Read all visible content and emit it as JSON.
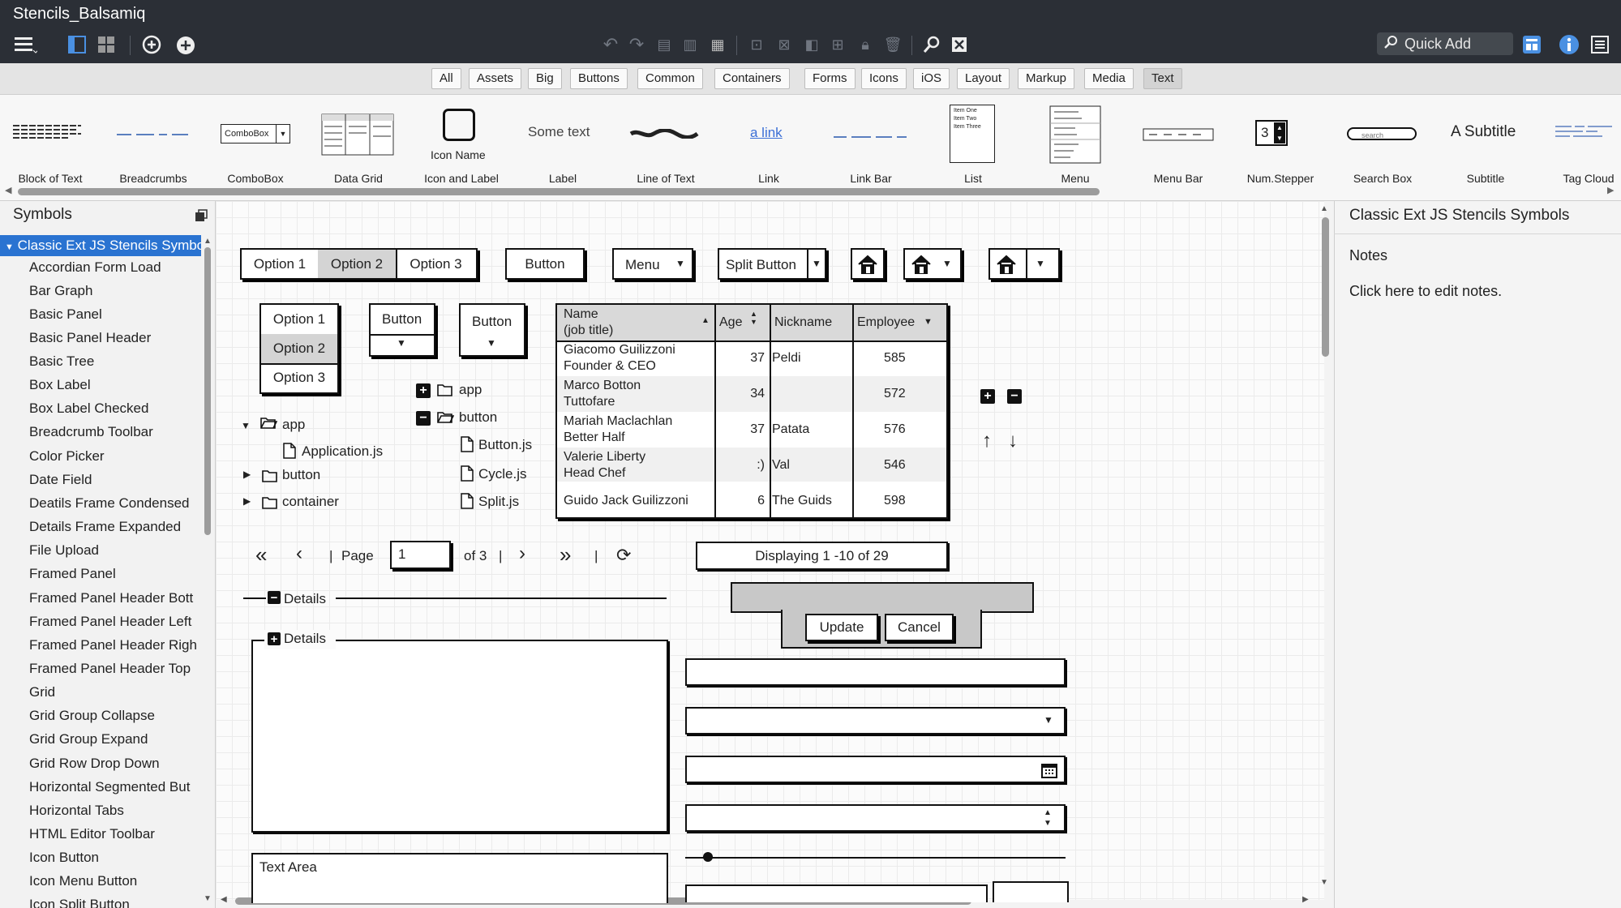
{
  "app": {
    "title": "Stencils_Balsamiq"
  },
  "toolbar": {
    "quick_add_placeholder": "Quick Add"
  },
  "filters": [
    "All",
    "Assets",
    "Big",
    "Buttons",
    "Common",
    "Containers",
    "Forms",
    "Icons",
    "iOS",
    "Layout",
    "Markup",
    "Media",
    "Text"
  ],
  "filter_selected": "Text",
  "library": {
    "items": [
      "Block of Text",
      "Breadcrumbs",
      "ComboBox",
      "Data Grid",
      "Icon and Label",
      "Label",
      "Line of Text",
      "Link",
      "Link Bar",
      "List",
      "Menu",
      "Menu Bar",
      "Num.Stepper",
      "Search Box",
      "Subtitle",
      "Tag Cloud"
    ],
    "previews": {
      "combobox": "ComboBox",
      "icon_name": "Icon Name",
      "label": "Some text",
      "link": "a link",
      "search": "search",
      "subtitle": "A Subtitle",
      "stepper": "3",
      "list_lines": [
        "Item One",
        "Item Two",
        "Item Three"
      ]
    }
  },
  "symbols": {
    "title": "Symbols",
    "selected": "Classic Ext JS Stencils Symbols",
    "items": [
      "Accordian Form Load",
      "Bar Graph",
      "Basic Panel",
      "Basic Panel Header",
      "Basic Tree",
      "Box Label",
      "Box Label Checked",
      "Breadcrumb Toolbar",
      "Color Picker",
      "Date Field",
      "Deatils Frame Condensed",
      "Details Frame Expanded",
      "File Upload",
      "Framed Panel",
      "Framed Panel Header Bott",
      "Framed Panel Header Left",
      "Framed Panel Header Righ",
      "Framed Panel Header Top",
      "Grid",
      "Grid Group Collapse",
      "Grid Group Expand",
      "Grid Row Drop Down",
      "Horizontal Segmented But",
      "Horizontal Tabs",
      "HTML Editor Toolbar",
      "Icon Button",
      "Icon Menu Button",
      "Icon Split Button"
    ]
  },
  "right_panel": {
    "title": "Classic Ext JS Stencils Symbols",
    "notes_label": "Notes",
    "notes_text": "Click here to edit notes."
  },
  "canvas": {
    "segmented": [
      "Option 1",
      "Option 2",
      "Option 3"
    ],
    "segmented_selected": "Option 2",
    "button": "Button",
    "menu": "Menu",
    "split_button": "Split Button",
    "vertical_segmented": [
      "Option 1",
      "Option 2",
      "Option 3"
    ],
    "vertical_selected": "Option 2",
    "btn_menu_1": "Button",
    "btn_menu_2": "Button",
    "tree1": {
      "app": "app",
      "app_file": "Application.js",
      "button": "button",
      "container": "container"
    },
    "tree2": {
      "app": "app",
      "button": "button",
      "files": [
        "Button.js",
        "Cycle.js",
        "Split.js"
      ]
    },
    "grid": {
      "headers": [
        "Name\n(job title)",
        "Age",
        "Nickname",
        "Employee"
      ],
      "rows": [
        {
          "name": "Giacomo Guilizzoni",
          "title": "Founder & CEO",
          "age": "37",
          "nick": "Peldi",
          "emp": "585"
        },
        {
          "name": "Marco Botton",
          "title": "Tuttofare",
          "age": "34",
          "nick": "",
          "emp": "572"
        },
        {
          "name": "Mariah Maclachlan",
          "title": "Better Half",
          "age": "37",
          "nick": "Patata",
          "emp": "576"
        },
        {
          "name": "Valerie Liberty",
          "title": "Head Chef",
          "age": ":)",
          "nick": "Val",
          "emp": "546"
        },
        {
          "name": "Guido Jack Guilizzoni",
          "title": "",
          "age": "6",
          "nick": "The Guids",
          "emp": "598"
        }
      ]
    },
    "pager": {
      "page_label": "Page",
      "page_value": "1",
      "of_label": "of 3"
    },
    "displaying": "Displaying 1 -10 of 29",
    "details_collapsed": "Details",
    "details_expanded": "Details",
    "row_editor": {
      "update": "Update",
      "cancel": "Cancel"
    },
    "text_area": "Text Area"
  },
  "colors": {
    "titlebar": "#2b2f36",
    "selection": "#2a73d1",
    "canvas": "#fbfbfb",
    "grid_header": "#d9d9d9"
  }
}
